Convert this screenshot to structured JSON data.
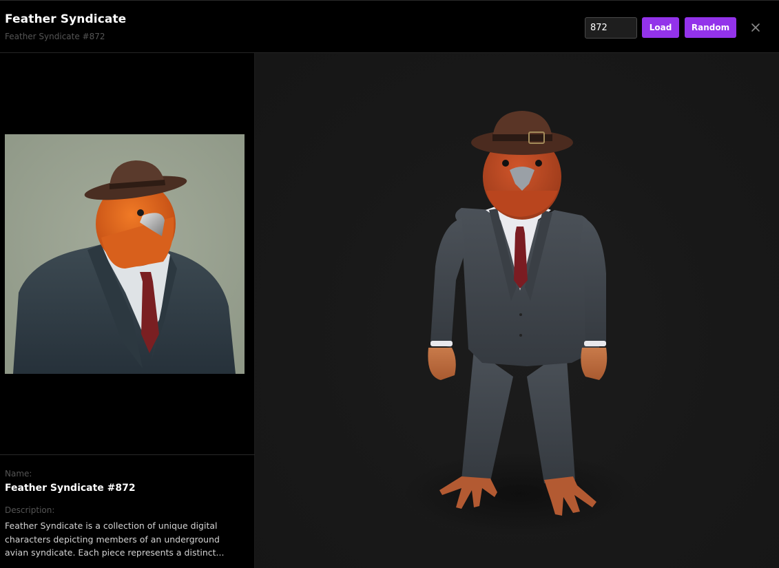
{
  "header": {
    "title": "Feather Syndicate",
    "subtitle": "Feather Syndicate #872",
    "token_input_value": "872",
    "load_label": "Load",
    "random_label": "Random"
  },
  "details": {
    "name_label": "Name:",
    "name_value": "Feather Syndicate #872",
    "description_label": "Description:",
    "description_value": "Feather Syndicate is a collection of unique digital characters depicting members of an underground avian syndicate. Each piece represents a distinct..."
  },
  "colors": {
    "accent": "#9333ea",
    "background": "#000000",
    "viewer_background": "#181818"
  },
  "icons": {
    "close": "close-icon"
  }
}
